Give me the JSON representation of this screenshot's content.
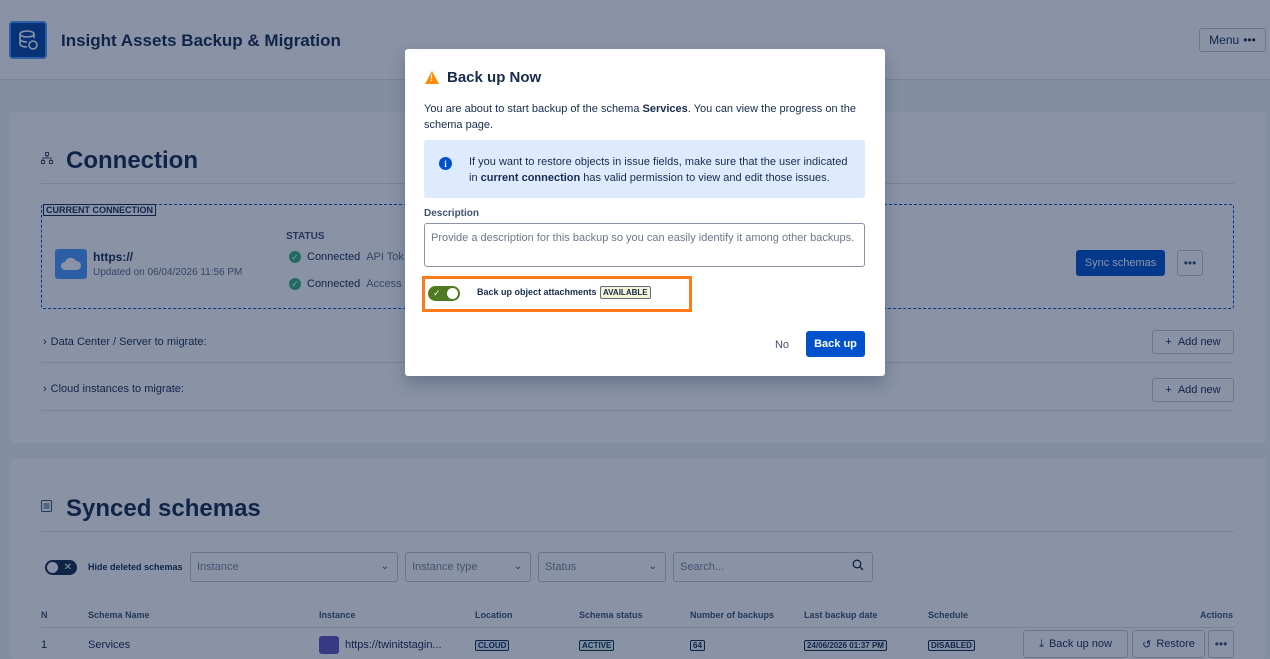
{
  "app": {
    "title": "Insight Assets Backup & Migration",
    "menu_label": "Menu"
  },
  "connection": {
    "title": "Connection",
    "current_tag": "CURRENT CONNECTION",
    "url": "https://",
    "updated": "Updated on 06/04/2026 11:56 PM",
    "status_label": "STATUS",
    "statuses": [
      {
        "state": "Connected",
        "detail": "API Tok"
      },
      {
        "state": "Connected",
        "detail": "Access"
      }
    ],
    "sync_button": "Sync schemas",
    "datacenter_label": "Data Center / Server to migrate:",
    "cloud_label": "Cloud instances to migrate:",
    "add_new": "Add new"
  },
  "synced": {
    "title": "Synced schemas",
    "hide_deleted": "Hide deleted schemas",
    "filters": {
      "instance": "Instance",
      "instance_type": "Instance type",
      "status": "Status",
      "search_placeholder": "Search..."
    },
    "columns": [
      "N",
      "Schema Name",
      "Instance",
      "Location",
      "Schema status",
      "Number of backups",
      "Last backup date",
      "Schedule",
      "Actions"
    ],
    "rows": [
      {
        "n": "1",
        "name": "Services",
        "instance": "https://twinitstagin...",
        "location": "CLOUD",
        "status": "ACTIVE",
        "backups": "64",
        "last_backup": "24/06/2026 01:37 PM",
        "schedule": "DISABLED"
      }
    ],
    "backup_now": "Back up now",
    "restore": "Restore"
  },
  "modal": {
    "title": "Back up Now",
    "text_before": "You are about to start backup of the schema ",
    "schema": "Services",
    "text_after": ". You can view the progress on the schema page.",
    "info_before": "If you want to restore objects in issue fields, make sure that the user indicated in ",
    "info_bold": "current connection",
    "info_after": " has valid permission to view and edit those issues.",
    "description_label": "Description",
    "description_placeholder": "Provide a description for this backup so you can easily identify it among other backups.",
    "attachments_label": "Back up object attachments",
    "available_badge": "AVAILABLE",
    "attachments_enabled": true,
    "no_button": "No",
    "backup_button": "Back up"
  },
  "colors": {
    "primary": "#0052cc",
    "highlight": "#ff7a1a",
    "toggle_on": "#4f7a22",
    "warning": "#ff8b00",
    "info_bg": "#deebff"
  }
}
